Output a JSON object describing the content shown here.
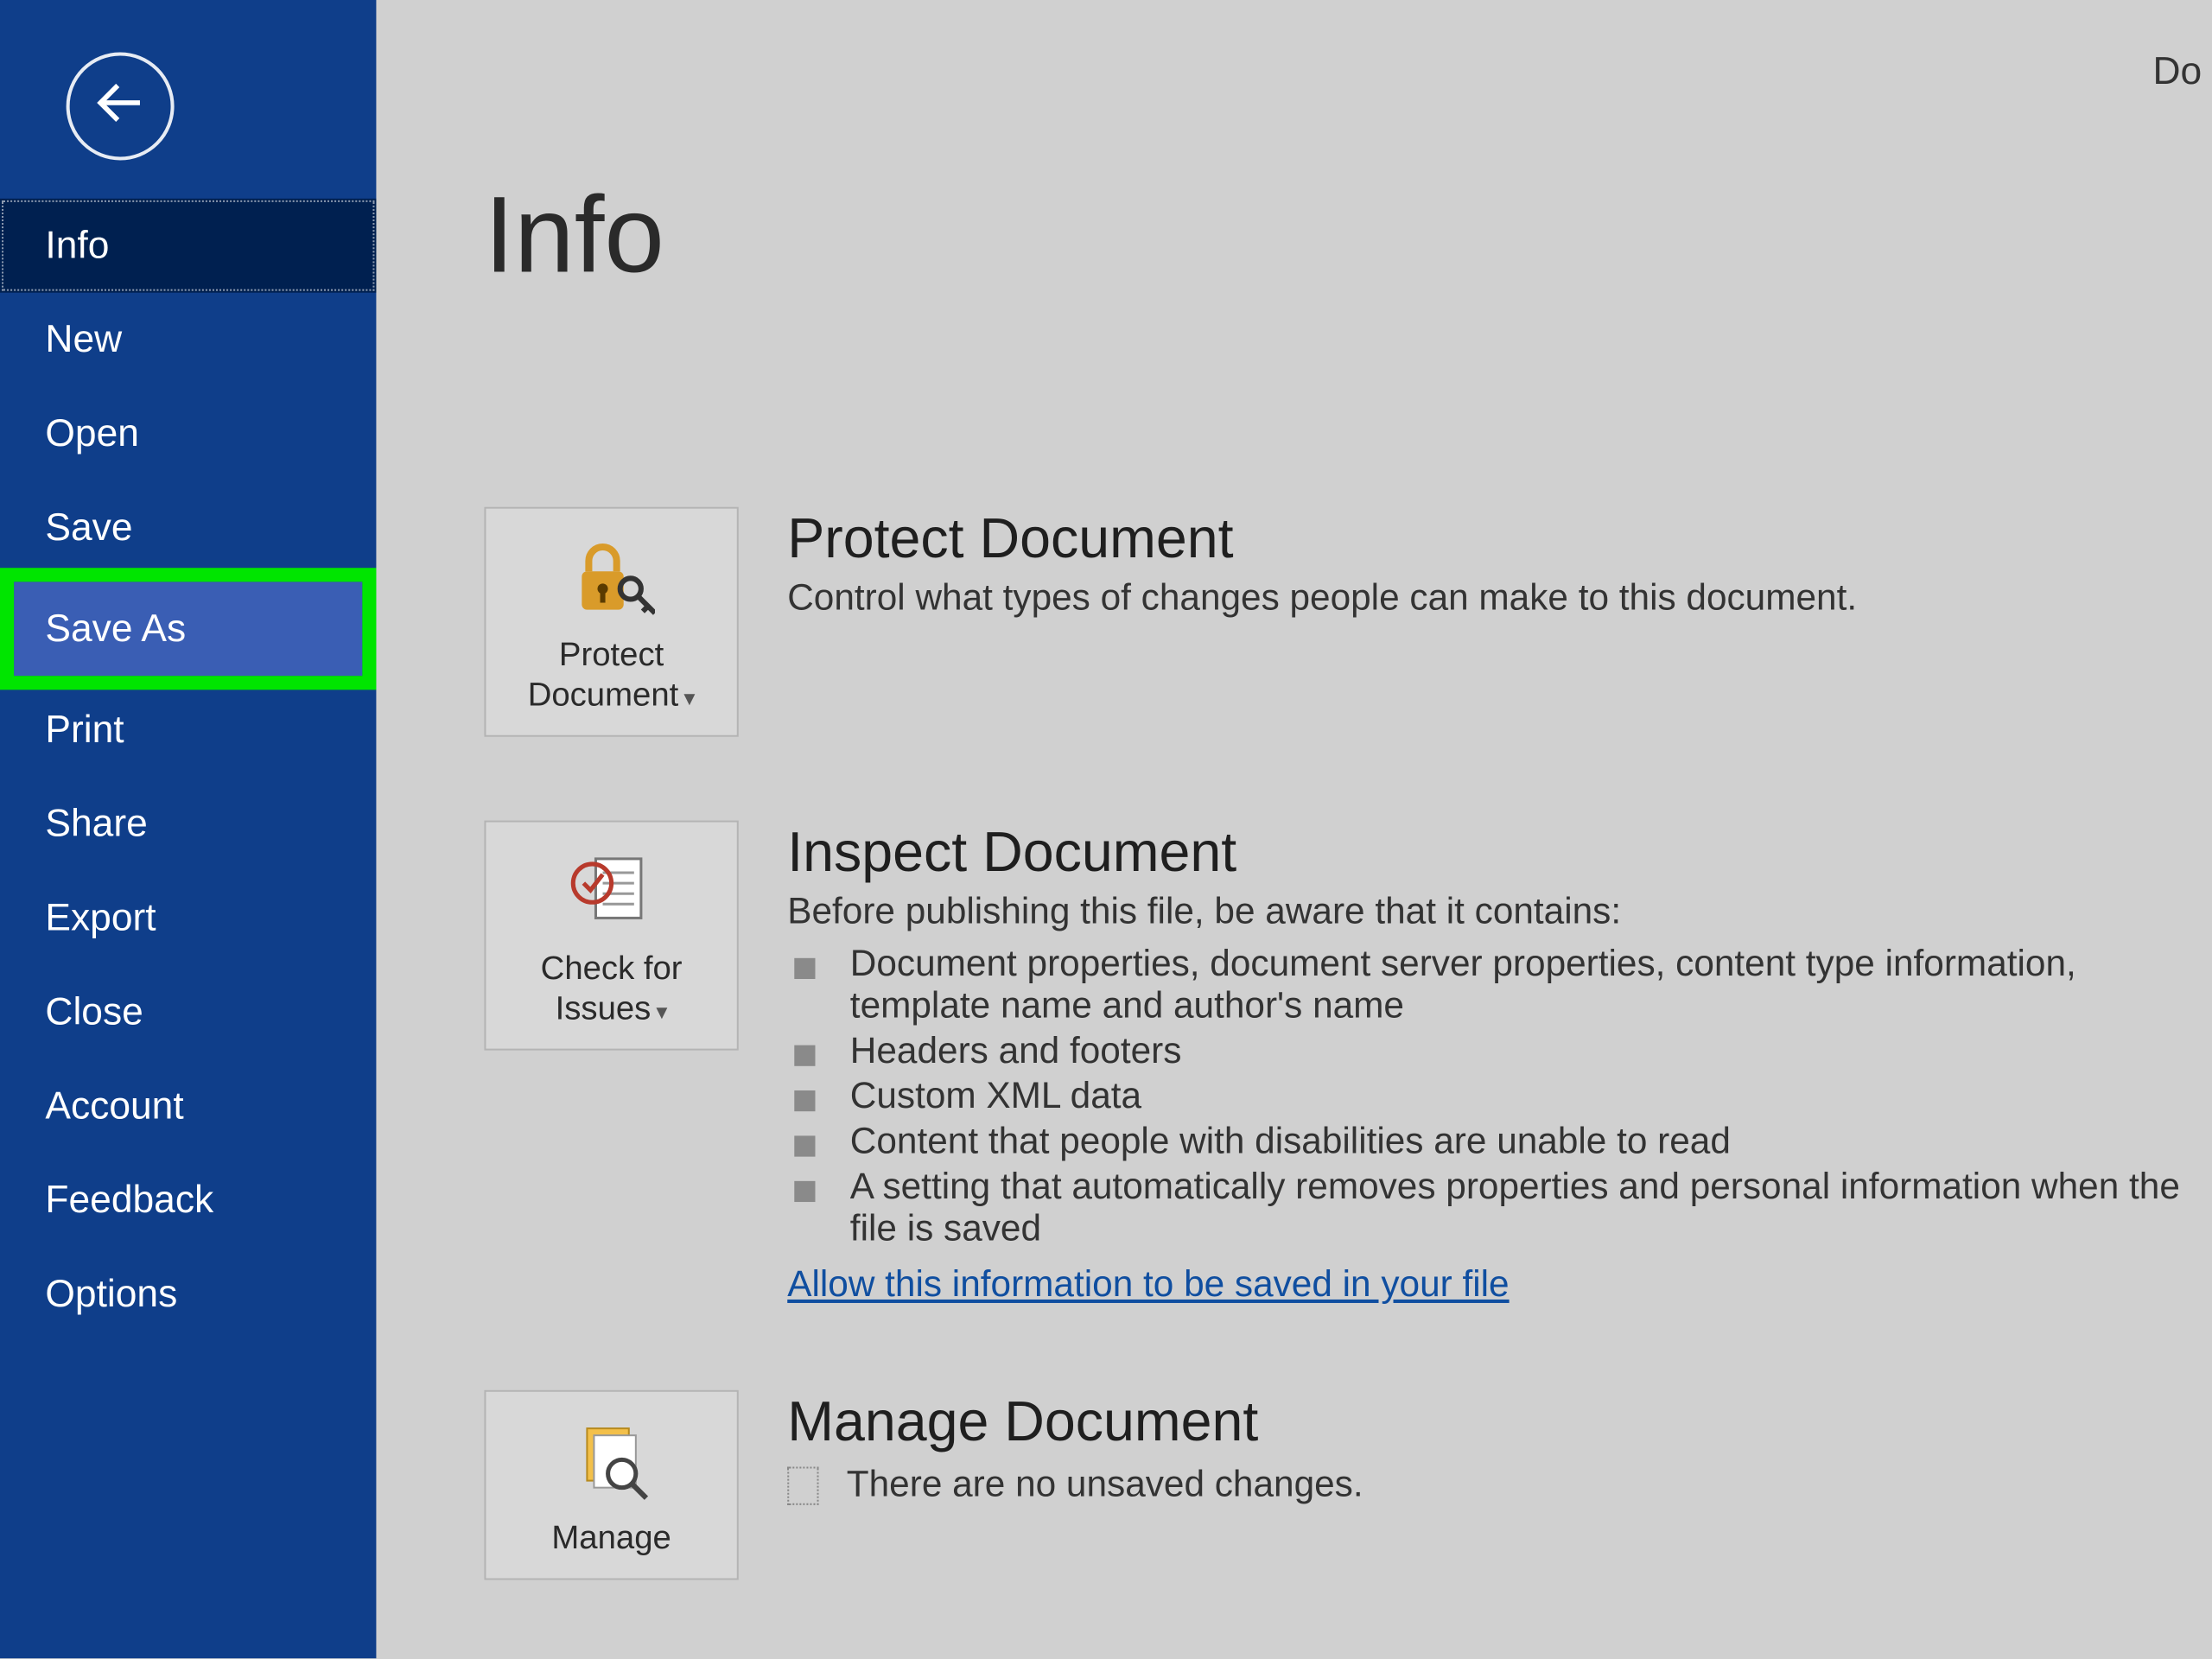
{
  "topRight": "Do",
  "sidebar": {
    "items": [
      {
        "label": "Info",
        "selected": true
      },
      {
        "label": "New"
      },
      {
        "label": "Open"
      },
      {
        "label": "Save"
      },
      {
        "label": "Save As",
        "highlighted": true
      },
      {
        "label": "Print"
      },
      {
        "label": "Share"
      },
      {
        "label": "Export"
      },
      {
        "label": "Close"
      }
    ],
    "footerItems": [
      {
        "label": "Account"
      },
      {
        "label": "Feedback"
      },
      {
        "label": "Options"
      }
    ]
  },
  "page": {
    "title": "Info",
    "protect": {
      "tileLabel": "Protect Document",
      "heading": "Protect Document",
      "desc": "Control what types of changes people can make to this document."
    },
    "inspect": {
      "tileLabel": "Check for Issues",
      "heading": "Inspect Document",
      "lead": "Before publishing this file, be aware that it contains:",
      "issues": [
        "Document properties, document server properties, content type information, template name and author's name",
        "Headers and footers",
        "Custom XML data",
        "Content that people with disabilities are unable to read",
        "A setting that automatically removes properties and personal information when the file is saved"
      ],
      "link": "Allow this information to be saved in your file"
    },
    "manage": {
      "tileLabel": "Manage",
      "heading": "Manage Document",
      "status": "There are no unsaved changes."
    }
  }
}
